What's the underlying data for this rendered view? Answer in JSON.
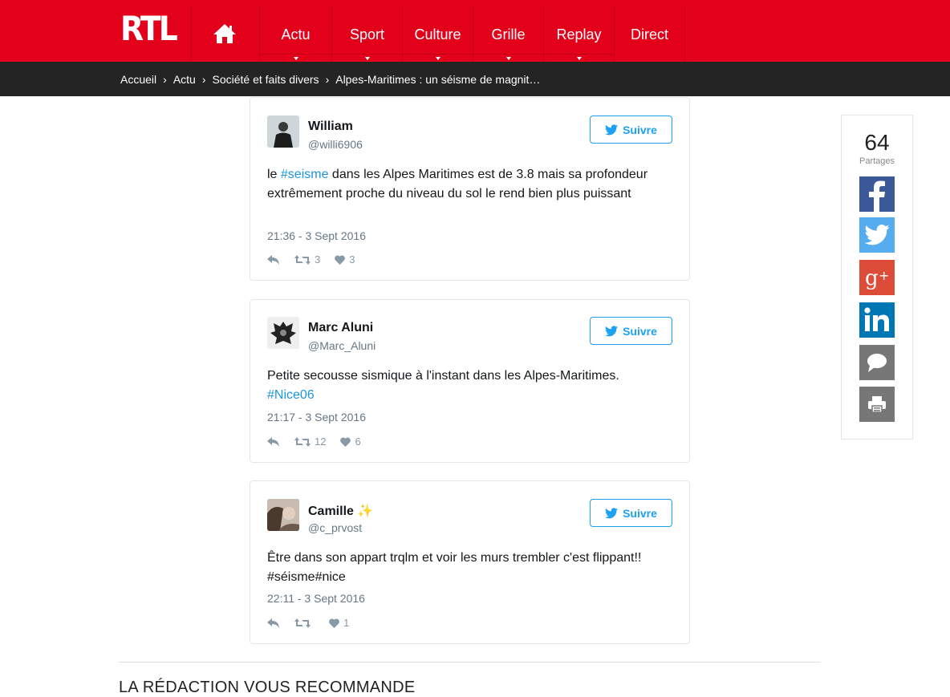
{
  "header": {
    "logo": "RTL",
    "nav": [
      {
        "label": "Actu",
        "dropdown": true
      },
      {
        "label": "Sport",
        "dropdown": true
      },
      {
        "label": "Culture",
        "dropdown": true
      },
      {
        "label": "Grille",
        "dropdown": true
      },
      {
        "label": "Replay",
        "dropdown": true
      },
      {
        "label": "Direct",
        "dropdown": false
      }
    ],
    "colors": {
      "brand": "#e2001a",
      "breadcrumb_bg": "#242424"
    }
  },
  "breadcrumb": [
    "Accueil",
    "Actu",
    "Société et faits divers",
    "Alpes-Maritimes : un séisme de magnit…"
  ],
  "breadcrumb_separator": "›",
  "tweets": [
    {
      "name": "William",
      "handle": "@willi6906",
      "follow_label": "Suivre",
      "text_before": "le ",
      "hashtag": "#seisme",
      "text_after": " dans les Alpes Maritimes est de 3.8 mais sa profondeur extrêmement proche du niveau du sol le rend bien plus puissant",
      "time": "21:36 - 3 Sept 2016",
      "retweets": "3",
      "likes": "3"
    },
    {
      "name": "Marc Aluni",
      "handle": "@Marc_Aluni",
      "follow_label": "Suivre",
      "text_before": "Petite secousse sismique à l'instant dans les Alpes-Maritimes. ",
      "hashtag": "#Nice06",
      "text_after": "",
      "time": "21:17 - 3 Sept 2016",
      "retweets": "12",
      "likes": "6"
    },
    {
      "name": "Camille ✨",
      "handle": "@c_prvost",
      "follow_label": "Suivre",
      "text_before": "Être dans son appart trqlm et voir les murs trembler c'est flippant!! #séisme#nice",
      "hashtag": "",
      "text_after": "",
      "time": "22:11 - 3 Sept 2016",
      "retweets": "",
      "likes": "1"
    }
  ],
  "share": {
    "count": "64",
    "label": "Partages",
    "buttons": [
      {
        "icon": "facebook-icon",
        "color": "#3b5998"
      },
      {
        "icon": "twitter-icon",
        "color": "#55acee"
      },
      {
        "icon": "google-plus-icon",
        "color": "#dd4b39"
      },
      {
        "icon": "linkedin-icon",
        "color": "#0077b5"
      },
      {
        "icon": "comment-icon",
        "color": "#777777"
      },
      {
        "icon": "print-icon",
        "color": "#777777"
      }
    ]
  },
  "recommend_title": "LA RÉDACTION VOUS RECOMMANDE"
}
